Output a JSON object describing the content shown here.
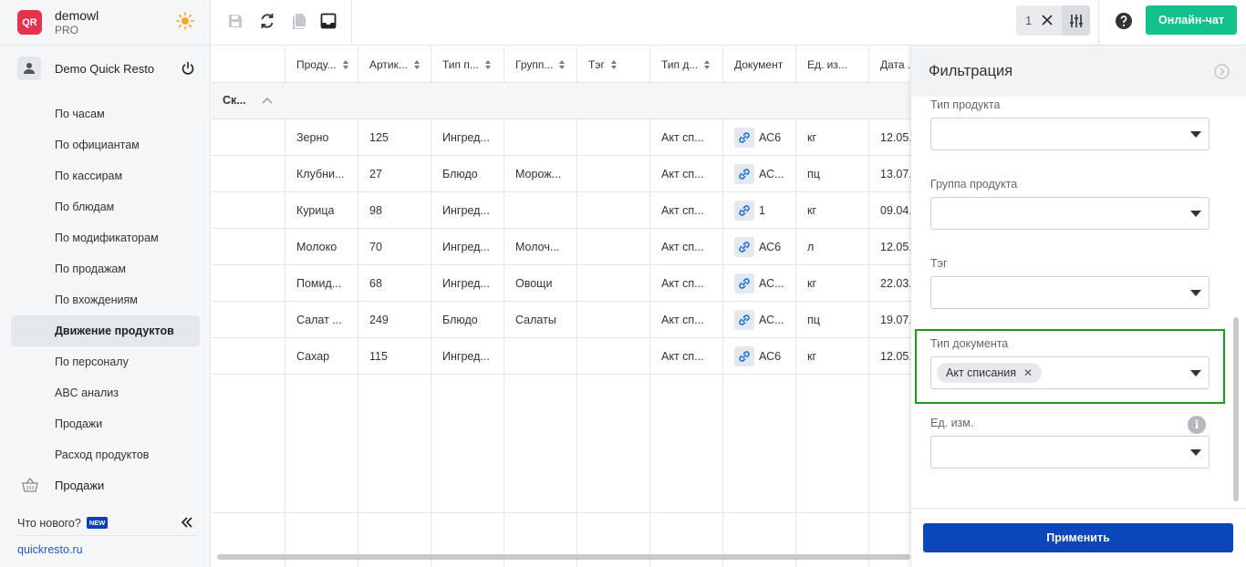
{
  "brand": {
    "name": "demowl",
    "plan": "PRO",
    "logo_text": "QR"
  },
  "user": {
    "name": "Demo Quick Resto"
  },
  "nav": {
    "items": [
      {
        "label": "По часам"
      },
      {
        "label": "По официантам"
      },
      {
        "label": "По кассирам"
      },
      {
        "label": "По блюдам"
      },
      {
        "label": "По модификаторам"
      },
      {
        "label": "По продажам"
      },
      {
        "label": "По вхождениям"
      },
      {
        "label": "Движение продуктов",
        "active": true
      },
      {
        "label": "По персоналу"
      },
      {
        "label": "ABC анализ"
      },
      {
        "label": "Продажи"
      },
      {
        "label": "Расход продуктов"
      }
    ],
    "section_label": "Продажи"
  },
  "footer": {
    "whats_new": "Что нового?",
    "new_badge": "NEW",
    "site": "quickresto.ru"
  },
  "toolbar": {
    "filter_count": "1",
    "chat_label": "Онлайн-чат"
  },
  "grid": {
    "columns": [
      "Проду...",
      "Артик...",
      "Тип п...",
      "Групп...",
      "Тэг",
      "Тип д...",
      "Документ",
      "Ед. из...",
      "Дата ..."
    ],
    "group_label": "Ск...",
    "rows": [
      {
        "product": "Зерно",
        "article": "125",
        "type": "Ингред...",
        "group": "",
        "tag": "",
        "doc_type": "Акт сп...",
        "document": "АС6",
        "unit": "кг",
        "date": "12.05."
      },
      {
        "product": "Клубни...",
        "article": "27",
        "type": "Блюдо",
        "group": "Морож...",
        "tag": "",
        "doc_type": "Акт сп...",
        "document": "АС...",
        "unit": "пц",
        "date": "13.07."
      },
      {
        "product": "Курица",
        "article": "98",
        "type": "Ингред...",
        "group": "",
        "tag": "",
        "doc_type": "Акт сп...",
        "document": "1",
        "unit": "кг",
        "date": "09.04."
      },
      {
        "product": "Молоко",
        "article": "70",
        "type": "Ингред...",
        "group": "Молоч...",
        "tag": "",
        "doc_type": "Акт сп...",
        "document": "АС6",
        "unit": "л",
        "date": "12.05."
      },
      {
        "product": "Помид...",
        "article": "68",
        "type": "Ингред...",
        "group": "Овощи",
        "tag": "",
        "doc_type": "Акт сп...",
        "document": "АС...",
        "unit": "кг",
        "date": "22.03."
      },
      {
        "product": "Салат ...",
        "article": "249",
        "type": "Блюдо",
        "group": "Салаты",
        "tag": "",
        "doc_type": "Акт сп...",
        "document": "АС...",
        "unit": "пц",
        "date": "19.07."
      },
      {
        "product": "Сахар",
        "article": "115",
        "type": "Ингред...",
        "group": "",
        "tag": "",
        "doc_type": "Акт сп...",
        "document": "АС6",
        "unit": "кг",
        "date": "12.05."
      }
    ]
  },
  "filter_panel": {
    "title": "Фильтрация",
    "fields": {
      "product_type": {
        "label": "Тип продукта",
        "value": ""
      },
      "product_group": {
        "label": "Группа продукта",
        "value": ""
      },
      "tag": {
        "label": "Тэг",
        "value": ""
      },
      "doc_type": {
        "label": "Тип документа",
        "selected_tag": "Акт списания"
      },
      "unit": {
        "label": "Ед. изм.",
        "value": ""
      }
    },
    "apply_label": "Применить"
  },
  "colors": {
    "accent": "#0b47b8",
    "chat": "#12c18b",
    "highlight": "#1a9e1a",
    "logo": "#e6334d"
  }
}
